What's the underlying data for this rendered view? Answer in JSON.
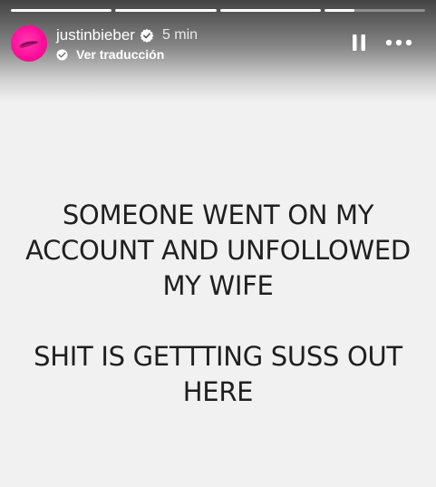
{
  "story": {
    "progress": [
      {
        "fill": 1.0
      },
      {
        "fill": 1.0
      },
      {
        "fill": 1.0
      },
      {
        "fill": 0.3
      }
    ],
    "username": "justinbieber",
    "verified": true,
    "time": "5 min",
    "translate_label": "Ver traducción",
    "accent": "#ff0f9a",
    "text_paragraphs": [
      [
        "SOMEONE WENT ON MY",
        "ACCOUNT AND UNFOLLOWED",
        "MY WIFE"
      ],
      [
        "SHIT IS GETTTING SUSS OUT",
        "HERE"
      ]
    ]
  },
  "icons": {
    "verified": "verified-badge-icon",
    "translate": "translate-icon",
    "pause": "pause-icon",
    "more": "more-options-icon"
  }
}
